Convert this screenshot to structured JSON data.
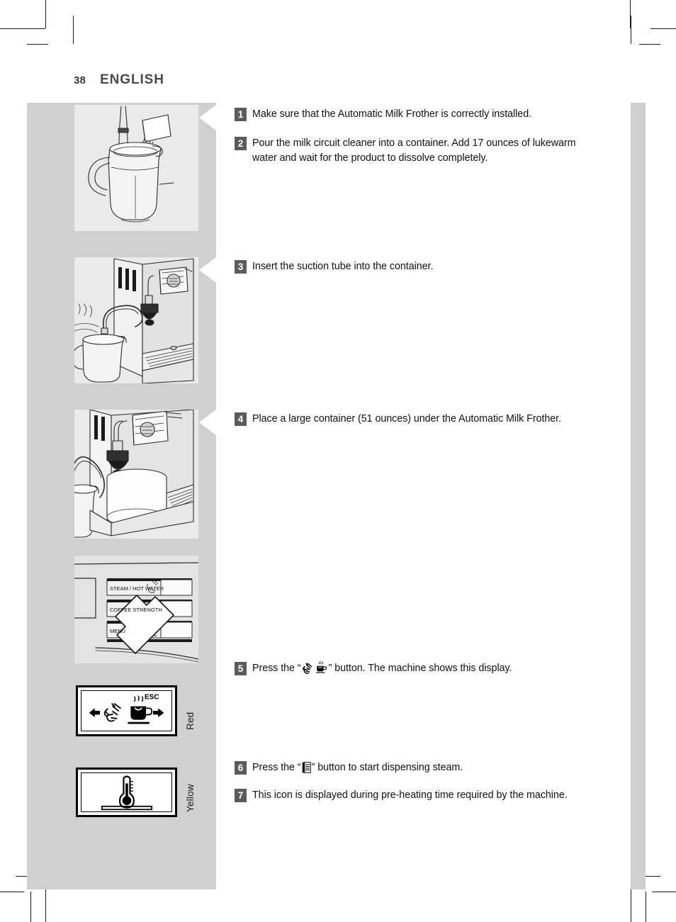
{
  "document": {
    "page_number": "38",
    "language_title": "ENGLISH"
  },
  "colors": {
    "band_gray": "#d0d0d0",
    "figure_gray": "#eaeaea",
    "badge_gray": "#5b5b5b",
    "text_black": "#111111",
    "title_gray": "#4a4a4a"
  },
  "steps": [
    {
      "number": "1",
      "text": "Make sure that the Automatic Milk Frother is correctly installed."
    },
    {
      "number": "2",
      "text": "Pour the milk circuit cleaner into a container. Add 17 ounces of lukewarm water and wait for the product to dissolve completely."
    },
    {
      "number": "3",
      "text": "Insert the suction tube into the container."
    },
    {
      "number": "4",
      "text": "Place a large container (51 ounces) under the Automatic Milk Frother."
    },
    {
      "number": "5",
      "text_before": "Press the “",
      "text_after": "” button. The machine shows this display.",
      "icons": [
        "steam-frother-icon",
        "hot-cup-icon"
      ]
    },
    {
      "number": "6",
      "text_before": "Press the “",
      "text_after": "” button to start dispensing steam.",
      "icons": [
        "menu-lines-icon"
      ]
    },
    {
      "number": "7",
      "text": "This icon is displayed during pre-heating time required by the machine."
    }
  ],
  "figures": [
    {
      "name": "figure-pour-cleaner-into-jug",
      "caption": "Milk circuit cleaner sachet being poured into a jug with suction tube"
    },
    {
      "name": "figure-suction-tube-in-container",
      "caption": "Suction tube inserted into the container next to the machine"
    },
    {
      "name": "figure-large-container-under-frother",
      "caption": "Large container placed under the Automatic Milk Frother"
    },
    {
      "name": "figure-control-panel",
      "caption": "Machine control panel with arrow pointing at the steam / hot water button"
    }
  ],
  "control_panel": {
    "buttons": [
      {
        "label": "STEAM / HOT WATER",
        "icon": "steam-hot-water-icon"
      },
      {
        "label": "COFFEE STRENGTH",
        "icon": "coffee-beans-icon"
      },
      {
        "label": "MENU",
        "icon": "menu-lines-icon"
      }
    ]
  },
  "displays": [
    {
      "name": "display-steam-selection",
      "esc_label": "ESC",
      "left_arrow": "arrow-left-icon",
      "right_arrow": "arrow-right-icon",
      "icons": [
        "steam-frother-icon",
        "hot-cup-icon"
      ],
      "color_label": "Red"
    },
    {
      "name": "display-preheating",
      "icons": [
        "thermometer-icon"
      ],
      "color_label": "Yellow"
    }
  ]
}
